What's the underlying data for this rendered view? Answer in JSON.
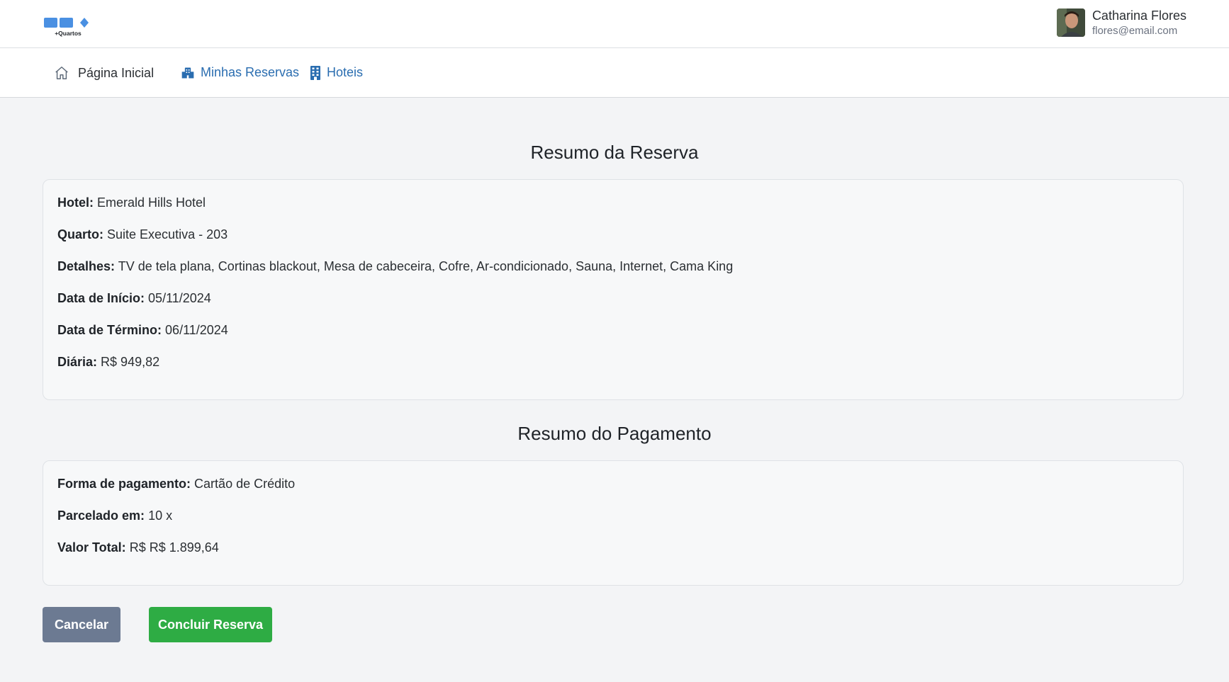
{
  "header": {
    "logo_text": "+Quartos",
    "user": {
      "name": "Catharina Flores",
      "email": "flores@email.com"
    }
  },
  "nav": {
    "items": [
      {
        "label": "Página Inicial",
        "icon": "home-icon"
      },
      {
        "label": "Minhas Reservas",
        "icon": "hotel-bookings-icon"
      },
      {
        "label": "Hoteis",
        "icon": "building-icon"
      }
    ]
  },
  "reservation": {
    "title": "Resumo da Reserva",
    "fields": [
      {
        "label": "Hotel:",
        "value": "Emerald Hills Hotel"
      },
      {
        "label": "Quarto:",
        "value": "Suite Executiva - 203"
      },
      {
        "label": "Detalhes:",
        "value": "TV de tela plana, Cortinas blackout, Mesa de cabeceira, Cofre, Ar-condicionado, Sauna, Internet, Cama King"
      },
      {
        "label": "Data de Início:",
        "value": "05/11/2024"
      },
      {
        "label": "Data de Término:",
        "value": "06/11/2024"
      },
      {
        "label": "Diária:",
        "value": "R$ 949,82"
      }
    ]
  },
  "payment": {
    "title": "Resumo do Pagamento",
    "fields": [
      {
        "label": "Forma de pagamento:",
        "value": "Cartão de Crédito"
      },
      {
        "label": "Parcelado em:",
        "value": "10 x"
      },
      {
        "label": "Valor Total:",
        "value": "R$ R$ 1.899,64"
      }
    ]
  },
  "actions": {
    "cancel_label": "Cancelar",
    "confirm_label": "Concluir Reserva"
  },
  "colors": {
    "link": "#2a6db0",
    "cancel": "#6c7a92",
    "confirm": "#2eac44",
    "logo": "#4a90e2"
  }
}
